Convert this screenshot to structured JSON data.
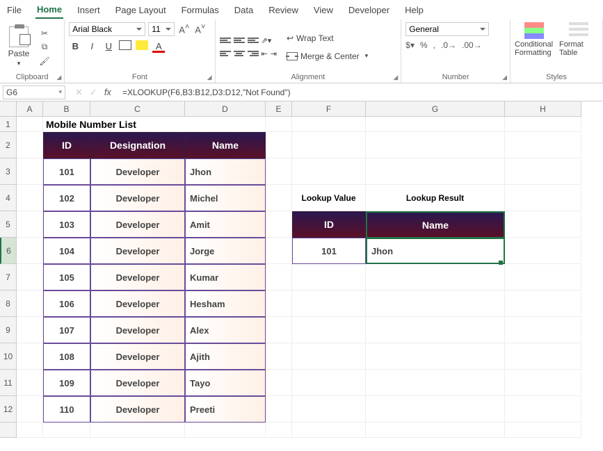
{
  "menu": {
    "file": "File",
    "home": "Home",
    "insert": "Insert",
    "page_layout": "Page Layout",
    "formulas": "Formulas",
    "data": "Data",
    "review": "Review",
    "view": "View",
    "developer": "Developer",
    "help": "Help"
  },
  "ribbon": {
    "clipboard": {
      "label": "Clipboard",
      "paste": "Paste"
    },
    "font": {
      "label": "Font",
      "name": "Arial Black",
      "size": "11"
    },
    "alignment": {
      "label": "Alignment",
      "wrap": "Wrap Text",
      "merge": "Merge & Center"
    },
    "number": {
      "label": "Number",
      "format": "General"
    },
    "styles": {
      "label": "Styles",
      "cond": "Conditional Formatting",
      "table": "Format Table"
    }
  },
  "fbar": {
    "cell": "G6",
    "formula": "=XLOOKUP(F6,B3:B12,D3:D12,\"Not Found\")"
  },
  "cols": [
    "A",
    "B",
    "C",
    "D",
    "E",
    "F",
    "G",
    "H"
  ],
  "rows": [
    "1",
    "2",
    "3",
    "4",
    "5",
    "6",
    "7",
    "8",
    "9",
    "10",
    "11",
    "12",
    ""
  ],
  "sheet": {
    "title": "Mobile Number List",
    "headers": {
      "id": "ID",
      "desig": "Designation",
      "name": "Name"
    },
    "data": [
      {
        "id": "101",
        "desig": "Developer",
        "name": "Jhon"
      },
      {
        "id": "102",
        "desig": "Developer",
        "name": "Michel"
      },
      {
        "id": "103",
        "desig": "Developer",
        "name": "Amit"
      },
      {
        "id": "104",
        "desig": "Developer",
        "name": "Jorge"
      },
      {
        "id": "105",
        "desig": "Developer",
        "name": "Kumar"
      },
      {
        "id": "106",
        "desig": "Developer",
        "name": "Hesham"
      },
      {
        "id": "107",
        "desig": "Developer",
        "name": "Alex"
      },
      {
        "id": "108",
        "desig": "Developer",
        "name": "Ajith"
      },
      {
        "id": "109",
        "desig": "Developer",
        "name": "Tayo"
      },
      {
        "id": "110",
        "desig": "Developer",
        "name": "Preeti"
      }
    ],
    "lookup": {
      "value_label": "Lookup Value",
      "result_label": "Lookup Result",
      "id_header": "ID",
      "name_header": "Name",
      "id": "101",
      "name": "Jhon"
    }
  }
}
